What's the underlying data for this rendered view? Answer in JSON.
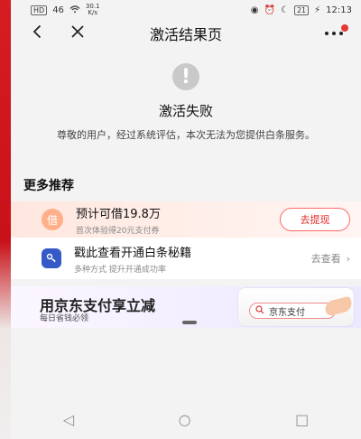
{
  "status_bar": {
    "left": {
      "hd": "HD",
      "signal": "46",
      "speed_top": "30.1",
      "speed_bottom": "K/s"
    },
    "right": {
      "battery": "21",
      "time": "12:13"
    }
  },
  "nav": {
    "title": "激活结果页"
  },
  "result": {
    "title": "激活失败",
    "desc": "尊敬的用户，经过系统评估，本次无法为您提供白条服务。"
  },
  "more": {
    "title": "更多推荐"
  },
  "card": {
    "loan": {
      "badge": "借",
      "title": "预计可借19.8万",
      "sub": "首次体验得20元支付券",
      "button": "去提现"
    },
    "tip": {
      "title": "戳此查看开通白条秘籍",
      "sub": "多种方式 提升开通成功率",
      "link": "去查看"
    }
  },
  "banner": {
    "title": "用京东支付享立减",
    "sub": "每日省钱必领",
    "search": "京东支付"
  },
  "icons": {
    "back": "back-icon",
    "close": "close-icon",
    "more": "more-icon",
    "alert": "alert-icon",
    "key": "key-icon",
    "chevron": "chevron-right-icon",
    "search": "search-icon"
  }
}
